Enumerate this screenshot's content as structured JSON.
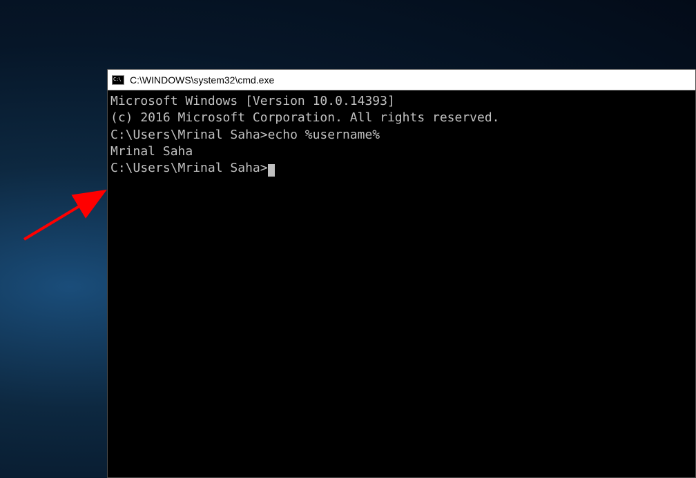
{
  "window": {
    "icon_text": "C:\\",
    "title": "C:\\WINDOWS\\system32\\cmd.exe"
  },
  "terminal": {
    "line1": "Microsoft Windows [Version 10.0.14393]",
    "line2": "(c) 2016 Microsoft Corporation. All rights reserved.",
    "blank1": "",
    "prompt1": "C:\\Users\\Mrinal Saha>",
    "command1": "echo %username%",
    "output1": "Mrinal Saha",
    "blank2": "",
    "prompt2": "C:\\Users\\Mrinal Saha>"
  }
}
